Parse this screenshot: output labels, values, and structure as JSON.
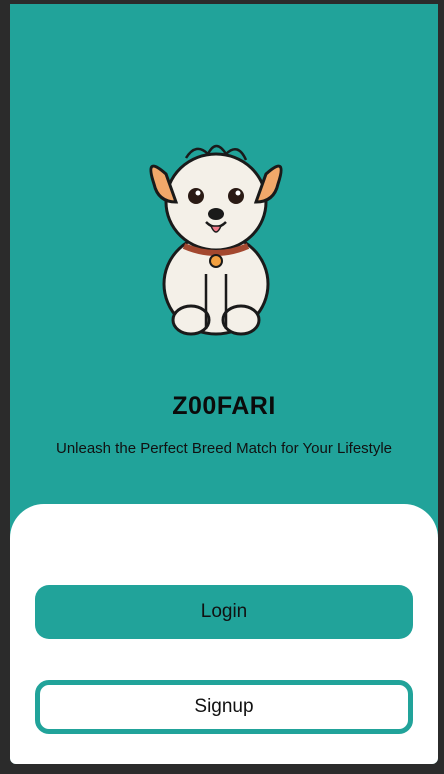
{
  "app": {
    "name": "Z00FARI",
    "tagline": "Unleash the Perfect Breed Match for Your Lifestyle"
  },
  "actions": {
    "login_label": "Login",
    "signup_label": "Signup"
  },
  "illustration": {
    "icon": "puppy-illustration"
  },
  "colors": {
    "brand": "#21a39a",
    "sheet": "#ffffff",
    "text": "#111111"
  }
}
